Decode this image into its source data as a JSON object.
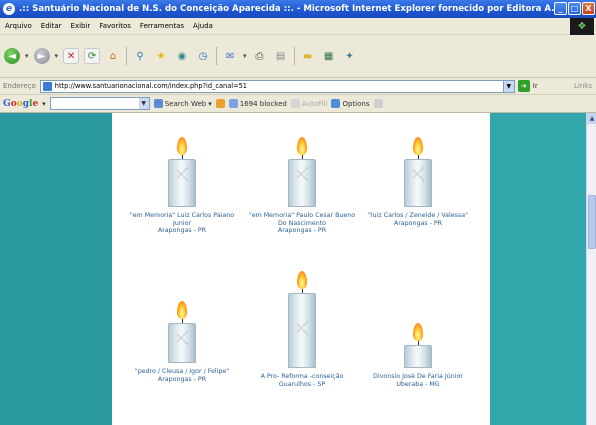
{
  "window": {
    "title": ".:: Santuário Nacional de N.S. do Conceição Aparecida ::. - Microsoft Internet Explorer fornecido por Editora A...",
    "buttons": [
      "_",
      "□",
      "X"
    ]
  },
  "menu": {
    "items": [
      "Arquivo",
      "Editar",
      "Exibir",
      "Favoritos",
      "Ferramentas",
      "Ajuda"
    ]
  },
  "address": {
    "label": "Endereço",
    "url": "http://www.santuarionacional.com/index.php?id_canal=51",
    "go_label": "Ir",
    "links_label": "Links"
  },
  "google": {
    "logo_letters": [
      "G",
      "o",
      "o",
      "g",
      "l",
      "e"
    ],
    "search_web": "Search Web",
    "blocked": "1694 blocked",
    "autofill": "AutoFill",
    "options": "Options"
  },
  "candles": [
    {
      "name": "\"em Memoria\" Luiz Carlos Paiano Junior",
      "location": "Arapongas - PR"
    },
    {
      "name": "\"em Memoria\" Paulo Cesar Bueno Do Nascimento",
      "location": "Arapongas - PR"
    },
    {
      "name": "\"luiz Carlos / Zeneide / Valessa\"",
      "location": "Arapongas - PR"
    },
    {
      "name": "\"pedro / Cleusa / Igor / Felipe\"",
      "location": "Arapongas - PR"
    },
    {
      "name": "A Pro- Reforma -conseição",
      "location": "Guarulhos - SP"
    },
    {
      "name": "Divonsio José De Faria Júnior",
      "location": "Uberaba - MG"
    }
  ],
  "colors": {
    "titlebar": "#1d55cf",
    "page_background": "#2b9aa0",
    "caption_text": "#2a5f96"
  }
}
